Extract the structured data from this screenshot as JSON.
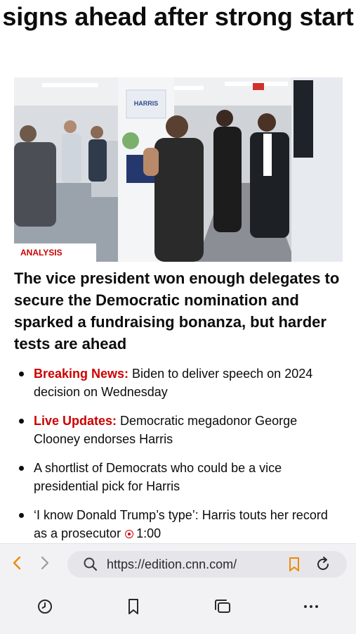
{
  "article": {
    "headline": "signs ahead after strong start",
    "hero_tag": "ANALYSIS",
    "hero_sign_text": "HARRIS",
    "subheadline": "The vice president won enough delegates to secure the Democratic nomination and sparked a fundraising bonanza, but harder tests are ahead",
    "bullets": [
      {
        "label": "Breaking News:",
        "text": " Biden to deliver speech on 2024 decision on Wednesday"
      },
      {
        "label": "Live Updates:",
        "text": " Democratic megadonor George Clooney endorses Harris"
      },
      {
        "label": "",
        "text": "A shortlist of Democrats who could be a vice presidential pick for Harris"
      },
      {
        "label": "",
        "text": "‘I know Donald Trump’s type’: Harris touts her record as a prosecutor",
        "video_duration": "1:00"
      }
    ]
  },
  "browser": {
    "url": "https://edition.cnn.com/",
    "accent_color": "#f08a00",
    "icons": [
      "back-icon",
      "forward-icon",
      "search-icon",
      "bookmark-icon",
      "reload-icon",
      "history-icon",
      "bookmarks-icon",
      "tabs-icon",
      "more-icon"
    ]
  }
}
